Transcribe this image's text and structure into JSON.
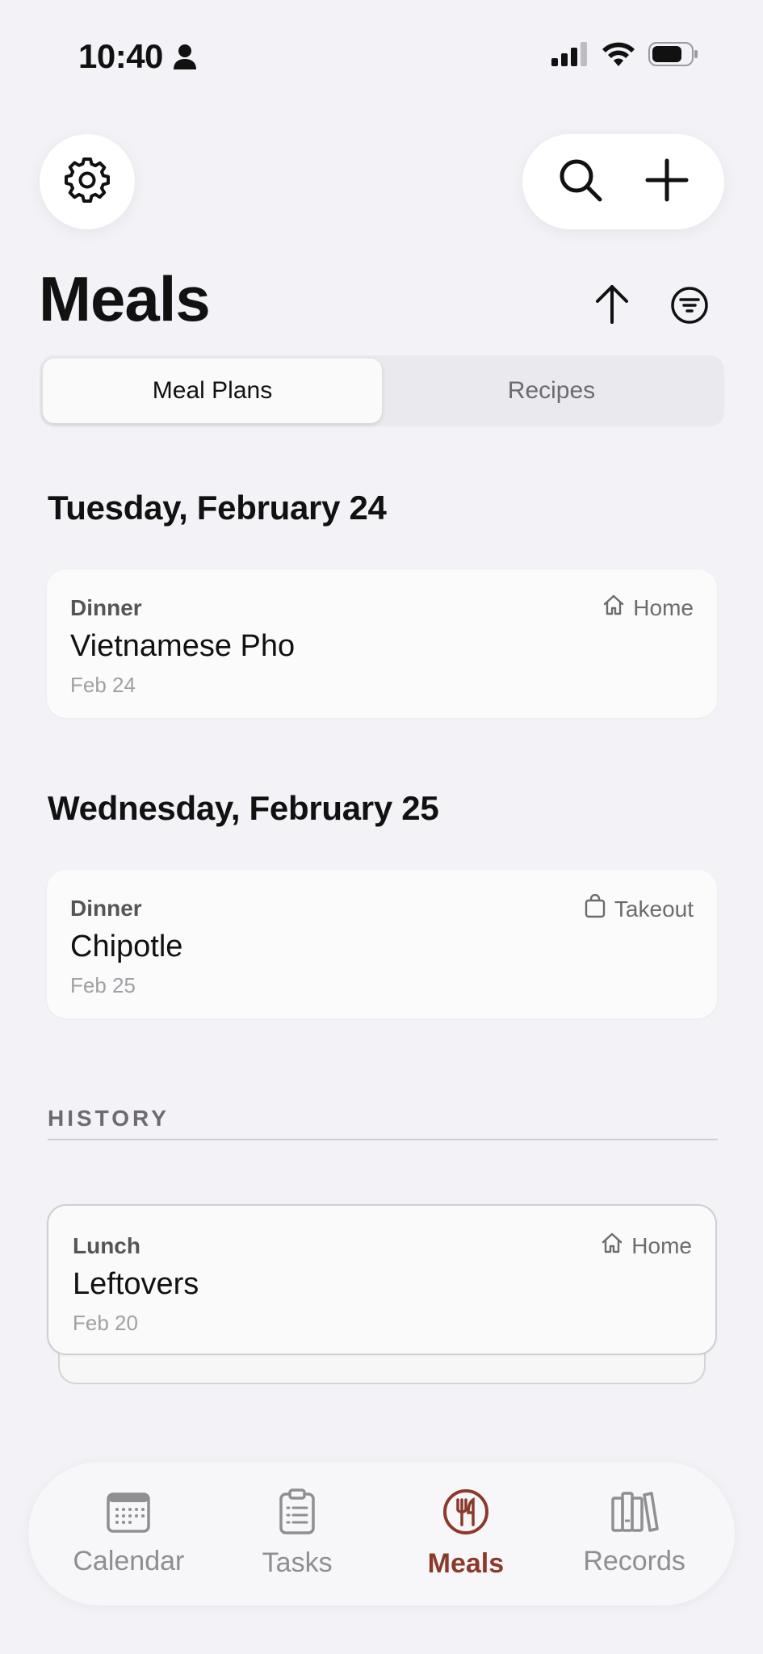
{
  "status_bar": {
    "time": "10:40"
  },
  "header": {
    "title": "Meals",
    "icons": {
      "settings": "gear-icon",
      "search": "search-icon",
      "add": "plus-icon",
      "sort": "arrow-up-icon",
      "filter": "filter-icon"
    }
  },
  "segments": {
    "meal_plans": "Meal Plans",
    "recipes": "Recipes",
    "selected": "Meal Plans"
  },
  "days": [
    {
      "heading": "Tuesday, February 24",
      "meal": {
        "type": "Dinner",
        "name": "Vietnamese Pho",
        "date": "Feb 24",
        "location": "Home",
        "location_icon": "house-icon"
      }
    },
    {
      "heading": "Wednesday, February 25",
      "meal": {
        "type": "Dinner",
        "name": "Chipotle",
        "date": "Feb 25",
        "location": "Takeout",
        "location_icon": "bag-icon"
      }
    }
  ],
  "history": {
    "label": "HISTORY",
    "items": [
      {
        "type": "Lunch",
        "name": "Leftovers",
        "date": "Feb 20",
        "location": "Home",
        "location_icon": "house-icon"
      }
    ]
  },
  "tabs": [
    {
      "label": "Calendar",
      "icon": "calendar-icon"
    },
    {
      "label": "Tasks",
      "icon": "clipboard-icon"
    },
    {
      "label": "Meals",
      "icon": "utensils-icon"
    },
    {
      "label": "Records",
      "icon": "books-icon"
    }
  ],
  "active_tab": "Meals",
  "colors": {
    "background": "#f2f2f7",
    "accent": "#8b3a2a",
    "card": "#fbfbfb",
    "muted": "#8e8e93"
  }
}
